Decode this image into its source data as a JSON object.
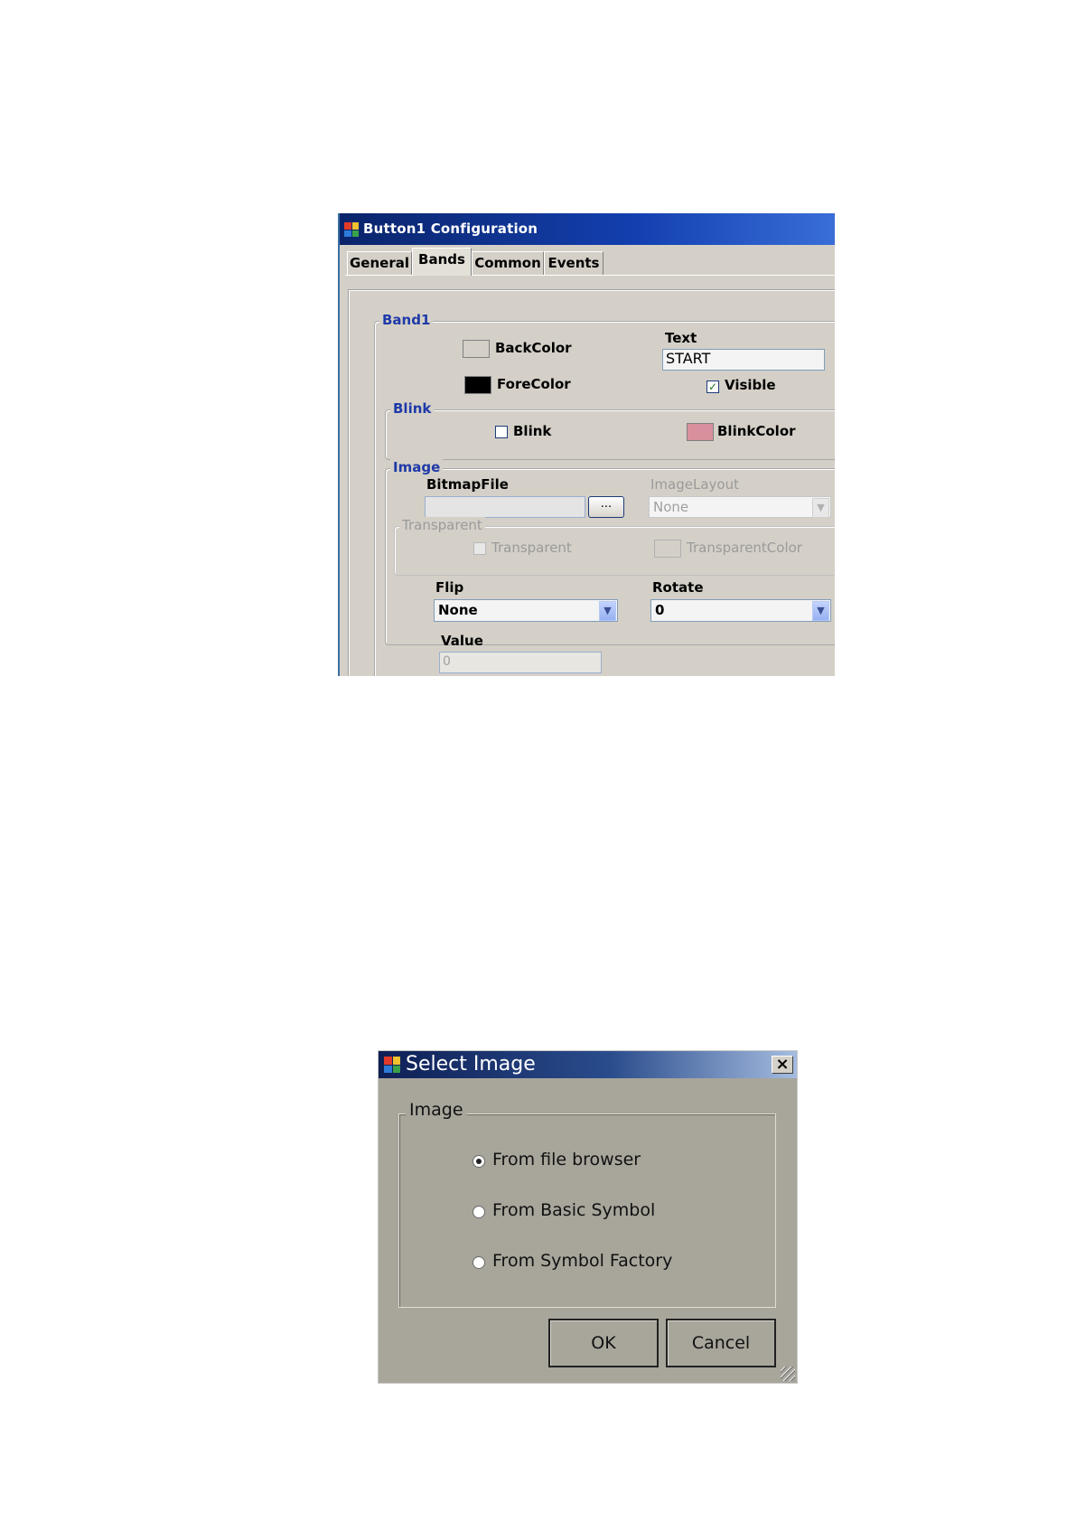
{
  "config_dialog": {
    "title": "Button1 Configuration",
    "tabs": [
      {
        "label": "General",
        "active": false
      },
      {
        "label": "Bands",
        "active": true
      },
      {
        "label": "Common",
        "active": false
      },
      {
        "label": "Events",
        "active": false
      }
    ],
    "band1": {
      "legend": "Band1",
      "back_color_label": "BackColor",
      "back_color": "#d4d0c8",
      "fore_color_label": "ForeColor",
      "fore_color": "#000000",
      "text_label": "Text",
      "text_value": "START",
      "visible_label": "Visible",
      "visible_checked": true
    },
    "blink": {
      "legend": "Blink",
      "blink_label": "Blink",
      "blink_checked": false,
      "blink_color_label": "BlinkColor",
      "blink_color": "#d9909e"
    },
    "image": {
      "legend": "Image",
      "bitmap_file_label": "BitmapFile",
      "bitmap_file_value": "",
      "browse_label": "...",
      "image_layout_label": "ImageLayout",
      "image_layout_value": "None",
      "transparent_legend": "Transparent",
      "transparent_label": "Transparent",
      "transparent_color_label": "TransparentColor",
      "flip_label": "Flip",
      "flip_value": "None",
      "rotate_label": "Rotate",
      "rotate_value": "0"
    },
    "value_label": "Value",
    "value_value": "0"
  },
  "select_image_dialog": {
    "title": "Select Image",
    "close_label": "×",
    "group_legend": "Image",
    "options": [
      {
        "label": "From file browser",
        "selected": true
      },
      {
        "label": "From Basic Symbol",
        "selected": false
      },
      {
        "label": "From Symbol Factory",
        "selected": false
      }
    ],
    "ok_label": "OK",
    "cancel_label": "Cancel"
  },
  "colors": {
    "dialog_bg": "#d4d0c8",
    "title_blue": "#0a246a",
    "group_label_blue": "#1f3aa8",
    "select_dialog_bg": "#a8a59b"
  }
}
